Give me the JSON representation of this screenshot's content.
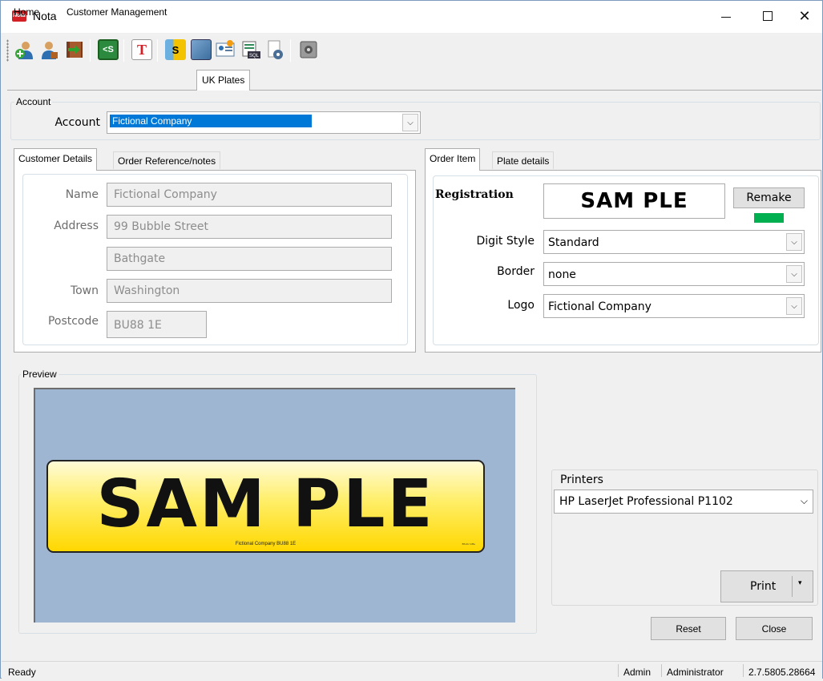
{
  "window": {
    "title": "Nota",
    "app_icon_text": "Nota"
  },
  "toolbar": {
    "icons": [
      "add-user-icon",
      "user-icon",
      "exit-icon",
      "back-icon",
      "text-icon",
      "s-icon",
      "gallery-icon",
      "contacts-icon",
      "sql-icon",
      "settings-icon",
      "safe-icon"
    ]
  },
  "main_tabs": {
    "home": "Home",
    "customer_management": "Customer Management",
    "uk_plates": "UK Plates"
  },
  "account": {
    "group_title": "Account",
    "label": "Account",
    "value": "Fictional Company"
  },
  "customer": {
    "tab_details": "Customer Details",
    "tab_notes": "Order Reference/notes",
    "name_label": "Name",
    "name": "Fictional Company",
    "address_label": "Address",
    "address1": "99 Bubble Street",
    "address2": "Bathgate",
    "town_label": "Town",
    "town": "Washington",
    "postcode_label": "Postcode",
    "postcode": "BU88 1E"
  },
  "order": {
    "tab_item": "Order Item",
    "tab_plate": "Plate details",
    "registration_label": "Registration",
    "registration": "SAM PLE",
    "remake_label": "Remake",
    "status_color": "#00b050",
    "digit_style_label": "Digit Style",
    "digit_style": "Standard",
    "border_label": "Border",
    "border": "none",
    "logo_label": "Logo",
    "logo": "Fictional Company"
  },
  "preview": {
    "title": "Preview",
    "plate_text": "SAM PLE",
    "plate_footer": "Fictional Company   BU88 1E",
    "plate_marker": "BS AU 145e",
    "bg_color": "#9eb6d2",
    "plate_color": "#ffd700"
  },
  "printers": {
    "label": "Printers",
    "selected": "HP LaserJet Professional P1102",
    "print_label": "Print"
  },
  "buttons": {
    "reset": "Reset",
    "close": "Close"
  },
  "status": {
    "text": "Ready",
    "user": "Admin",
    "role": "Administrator",
    "version": "2.7.5805.28664"
  }
}
